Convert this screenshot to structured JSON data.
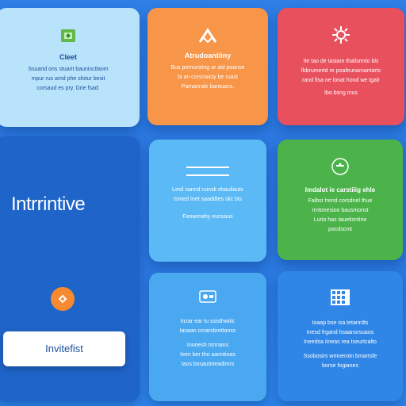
{
  "colors": {
    "background": "#2a76de",
    "card_light_blue": "#b9e3fb",
    "card_orange": "#f79548",
    "card_red": "#e9505e",
    "card_dark_blue": "#1f64c8",
    "card_sky": "#5bbaf5",
    "card_green": "#4bb34a",
    "card_blue": "#4aa8f0",
    "card_mid_blue": "#2f86e6"
  },
  "cards": {
    "c1": {
      "icon": "square-logo-icon",
      "heading": "Cleet",
      "lines": [
        "Ssuand ons stuarit baunisctlaom",
        "mpur rus amd phe sfotur besit",
        "corsaud es pry. Drie fsad."
      ]
    },
    "c2": {
      "icon": "arrow-chevron-icon",
      "heading": "Atrudoantiiny",
      "lines": [
        "Bus pemursting ar aid poanse",
        "bi an corsnaicty be ruast",
        "Pamanrale bantuans."
      ]
    },
    "c3": {
      "icon": "gear-burst-icon",
      "heading": "",
      "lines": [
        "Ite tao de tasiam thalisrmto bls",
        "fbbrumertd re poafeunamantarts",
        "rand fisa ne lonat hond we tgalr",
        "Ibo bsng mus"
      ]
    },
    "c4": {
      "title": "Intrrintive",
      "icon": "chevron-badge-icon",
      "cta": "Invitefist"
    },
    "c5": {
      "icon": "menu-lines-icon",
      "lines": [
        "Lesil sannd ruinsk ebauliauts",
        "Ismed Inet saaddtes slic bis",
        "Fanaenahy eunsaus"
      ]
    },
    "c6": {
      "icon": "circle-target-icon",
      "heading": "Imdalot ie carstiiig ehle",
      "lines": [
        "Falbsr hend corsdnel thue",
        "rrntonesioo bausmonst",
        "Lurio has tauetisntine",
        "pocdscmt"
      ]
    },
    "c7": {
      "icon": "card-wallet-icon",
      "lines": [
        "Inzar ear tu ssisthwitic",
        "Iasaan cmarsbrettanss",
        "Inunesh tsrrnans",
        "Ieen ber tho aanntinas",
        "Iaos bssautnteadimrs"
      ]
    },
    "c8": {
      "icon": "grid-calendar-icon",
      "lines": [
        "Ioaap bse isa tetanrdts",
        "Inesd frgand hsaansrsuaos",
        "Ineedsa Iineas rea tseurtcalto",
        "Ssobosirs wmnerotn bmartsfe",
        "borse fogianes"
      ]
    }
  }
}
